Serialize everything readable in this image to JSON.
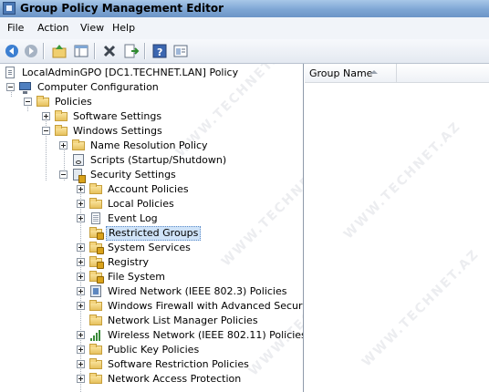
{
  "window": {
    "title": "Group Policy Management Editor"
  },
  "menu": [
    "File",
    "Action",
    "View",
    "Help"
  ],
  "toolbar": {
    "buttons": [
      "back-icon",
      "forward-icon",
      "up-folder-icon",
      "show-hide-tree-icon",
      "delete-icon",
      "export-list-icon",
      "help-icon",
      "properties-icon"
    ]
  },
  "tree": {
    "root": "LocalAdminGPO [DC1.TECHNET.LAN] Policy",
    "computer_configuration": "Computer Configuration",
    "policies": "Policies",
    "software_settings": "Software Settings",
    "windows_settings": "Windows Settings",
    "name_resolution_policy": "Name Resolution Policy",
    "scripts": "Scripts (Startup/Shutdown)",
    "security_settings": "Security Settings",
    "account_policies": "Account Policies",
    "local_policies": "Local Policies",
    "event_log": "Event Log",
    "restricted_groups": "Restricted Groups",
    "system_services": "System Services",
    "registry": "Registry",
    "file_system": "File System",
    "wired_network": "Wired Network (IEEE 802.3) Policies",
    "windows_firewall": "Windows Firewall with Advanced Security",
    "network_list_manager": "Network List Manager Policies",
    "wireless_network": "Wireless Network (IEEE 802.11) Policies",
    "public_key": "Public Key Policies",
    "software_restriction": "Software Restriction Policies",
    "network_access_protection": "Network Access Protection"
  },
  "list": {
    "column_group_name": "Group Name"
  },
  "watermark": "WWW.TECHNET.AZ"
}
